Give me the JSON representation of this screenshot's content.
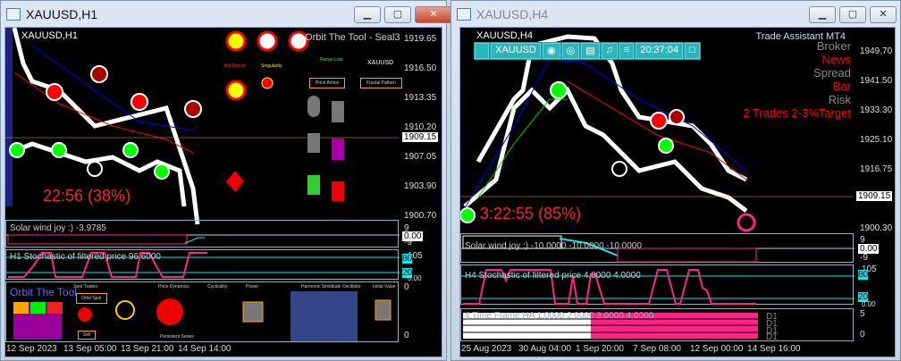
{
  "left": {
    "title": "XAUUSD,H1",
    "chart_label": "XAUUSD,H1",
    "overlay": "Orbit The Tool - Seal3",
    "timer": "22:56 (38%)",
    "prices": [
      "1919.65",
      "1916.50",
      "1913.35",
      "1910.20",
      "1907.05",
      "1903.90",
      "1900.70"
    ],
    "current_price": "1909.15",
    "ind1": {
      "label": "Solar wind joy :) -3.9785",
      "scale": [
        "9",
        "0.00",
        "-9"
      ]
    },
    "ind2": {
      "label": "H1 Stochastic of filtered price 96.6000",
      "scale": [
        "105",
        "80",
        "20",
        "0.00"
      ]
    },
    "ind3": {
      "label": "Orbit The Tool",
      "scale": [
        "0",
        "0"
      ],
      "sections": [
        "Spot Trades",
        "Price Dynamics",
        "Cyclicality",
        "Power",
        "Harmonic Similitude Oscillator",
        "Initial Value",
        "Persistent Series"
      ],
      "buttons": [
        "Orbit Spot",
        "Sell"
      ]
    },
    "panel": {
      "labels": [
        "Bid Market",
        "Singularity",
        "Range Low",
        "Price Action",
        "Fractal Pattern",
        "XAUUSD"
      ]
    },
    "times": [
      "12 Sep 2023",
      "13 Sep 05:00",
      "13 Sep 21:00",
      "14 Sep 14:00"
    ]
  },
  "right": {
    "title": "XAUUSD,H4",
    "chart_label": "XAUUSD,H4",
    "timer": "3:22:55 (85%)",
    "toolbar": {
      "symbol": "XAUUSD",
      "clock": "20:37:04"
    },
    "assistant": {
      "title": "Trade Assistant MT4",
      "items": [
        {
          "t": "Broker",
          "c": "#888"
        },
        {
          "t": "News",
          "c": "#f00"
        },
        {
          "t": "Spread",
          "c": "#888"
        },
        {
          "t": "Bar",
          "c": "#f00"
        },
        {
          "t": "Risk",
          "c": "#888"
        },
        {
          "t": "2 Trades 2-3%Target",
          "c": "#f00"
        }
      ]
    },
    "prices": [
      "1949.70",
      "1941.50",
      "1933.30",
      "1925.10",
      "1916.75",
      "1900.30"
    ],
    "current_price": "1909.15",
    "ind1": {
      "label": "Solar wind joy :) -10.0000 -10.0000 -10.0000",
      "scale": [
        "9",
        "0.00",
        "-9"
      ]
    },
    "ind2": {
      "label": "H4 Stochastic of filtered price 4.0000 4.0000",
      "scale": [
        "105",
        "80",
        "20",
        "0.00"
      ]
    },
    "ind3": {
      "label": "4 Time Frame HA 1.0000 2.0000 3.0000 4.0000",
      "scale": [
        "5",
        "0"
      ],
      "tags": [
        "D1",
        "D1",
        "D1",
        "D1"
      ]
    },
    "times": [
      "25 Aug 2023",
      "30 Aug 04:00",
      "1 Sep 20:00",
      "7 Sep 08:00",
      "12 Sep 00:00",
      "14 Sep 16:00"
    ]
  }
}
